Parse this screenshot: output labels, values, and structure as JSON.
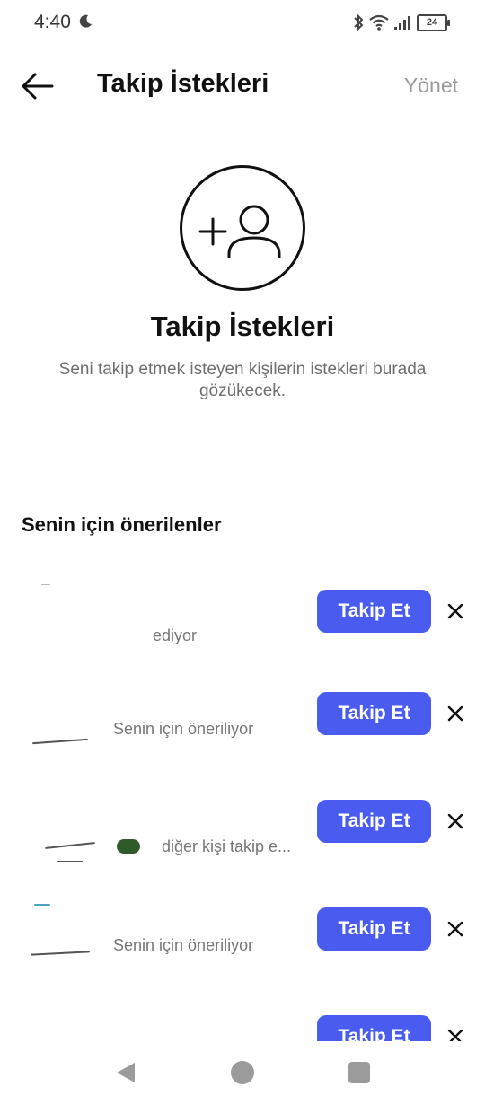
{
  "status_bar": {
    "time": "4:40",
    "battery": "24",
    "icons": [
      "moon-icon",
      "bluetooth-icon",
      "wifi-icon",
      "signal-icon",
      "battery-icon"
    ]
  },
  "header": {
    "title": "Takip İstekleri",
    "manage_label": "Yönet"
  },
  "empty_state": {
    "title": "Takip İstekleri",
    "description": "Seni takip etmek isteyen kişilerin istekleri burada gözükecek."
  },
  "suggestions": {
    "title": "Senin için önerilenler",
    "items": [
      {
        "subtitle": "ediyor",
        "button": "Takip Et"
      },
      {
        "subtitle": "Senin için öneriliyor",
        "button": "Takip Et"
      },
      {
        "subtitle": "diğer kişi takip e...",
        "button": "Takip Et"
      },
      {
        "subtitle": "Senin için öneriliyor",
        "button": "Takip Et"
      },
      {
        "subtitle": "",
        "button": "Takip Et"
      }
    ]
  },
  "colors": {
    "accent": "#4a5cf0",
    "muted_text": "#6f6f6f",
    "manage_text": "#9a9a9a"
  }
}
